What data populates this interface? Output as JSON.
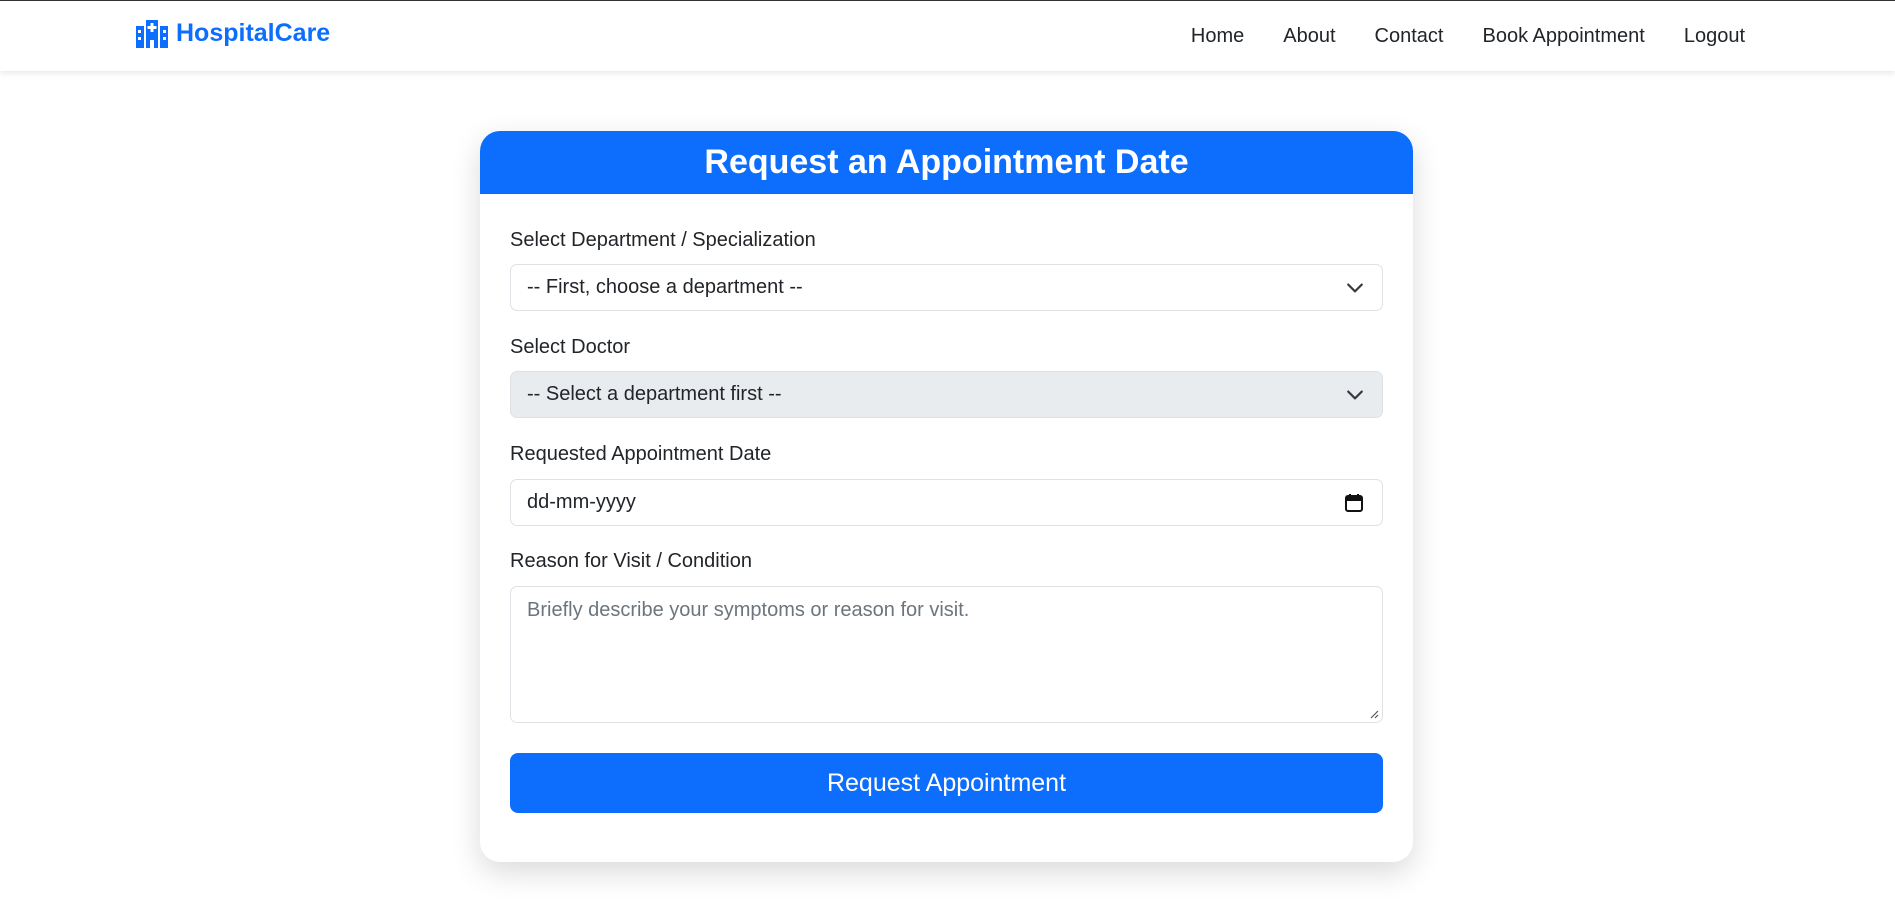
{
  "navbar": {
    "brand": "HospitalCare",
    "brand_icon": "hospital-icon",
    "links": [
      "Home",
      "About",
      "Contact",
      "Book Appointment",
      "Logout"
    ]
  },
  "form": {
    "title": "Request an Appointment Date",
    "department": {
      "label": "Select Department / Specialization",
      "value": "-- First, choose a department --"
    },
    "doctor": {
      "label": "Select Doctor",
      "value": "-- Select a department first --"
    },
    "date": {
      "label": "Requested Appointment Date",
      "value": "dd-mm-yyyy"
    },
    "reason": {
      "label": "Reason for Visit / Condition",
      "placeholder": "Briefly describe your symptoms or reason for visit."
    },
    "submit_label": "Request Appointment"
  },
  "colors": {
    "primary": "#0d6efd",
    "disabled_field": "#e9ecef",
    "border": "#dee2e6"
  }
}
